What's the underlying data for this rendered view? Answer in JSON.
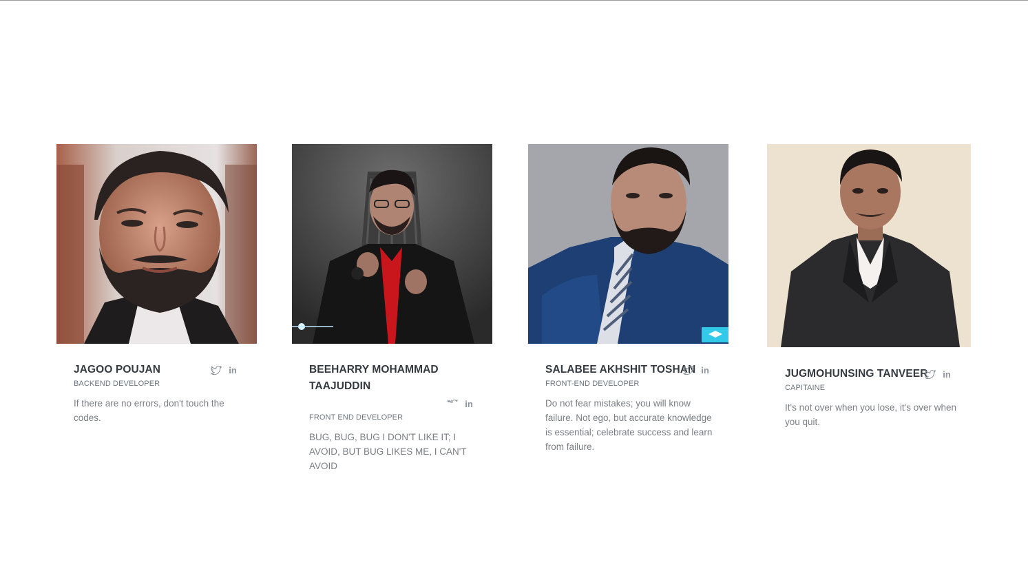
{
  "team": [
    {
      "name": "JAGOO POUJAN",
      "role": "BACKEND DEVELOPER",
      "quote": "If there are no errors, don't touch the codes.",
      "photo_alt": "Portrait of Jagoo Poujan"
    },
    {
      "name_line1": "BEEHARRY MOHAMMAD",
      "name_line2": "TAAJUDDIN",
      "role": "FRONT END DEVELOPER",
      "quote": "BUG, BUG, BUG I DON'T LIKE IT; I AVOID, BUT BUG LIKES ME, I CAN'T AVOID",
      "photo_alt": "Portrait of Beeharry Mohammad Taajuddin"
    },
    {
      "name": "SALABEE AKHSHIT TOSHAN",
      "role": "FRONT-END DEVELOPER",
      "quote": "Do not fear mistakes; you will know failure. Not ego, but accurate knowledge is essential; celebrate success and learn from failure.",
      "photo_alt": "Portrait of Salabee Akhshit Toshan"
    },
    {
      "name": "JUGMOHUNSING TANVEER",
      "role": "CAPITAINE",
      "quote": "It's not over when you lose, it's over when you quit.",
      "photo_alt": "Portrait of Jugmohunsing Tanveer"
    }
  ],
  "social": {
    "twitter_icon": "twitter-icon",
    "linkedin_text": "in"
  },
  "colors": {
    "name": "#343a40",
    "role": "#6c757d",
    "quote": "#7a7f85",
    "icon": "#8c939b",
    "badge": "#33c9e8"
  }
}
